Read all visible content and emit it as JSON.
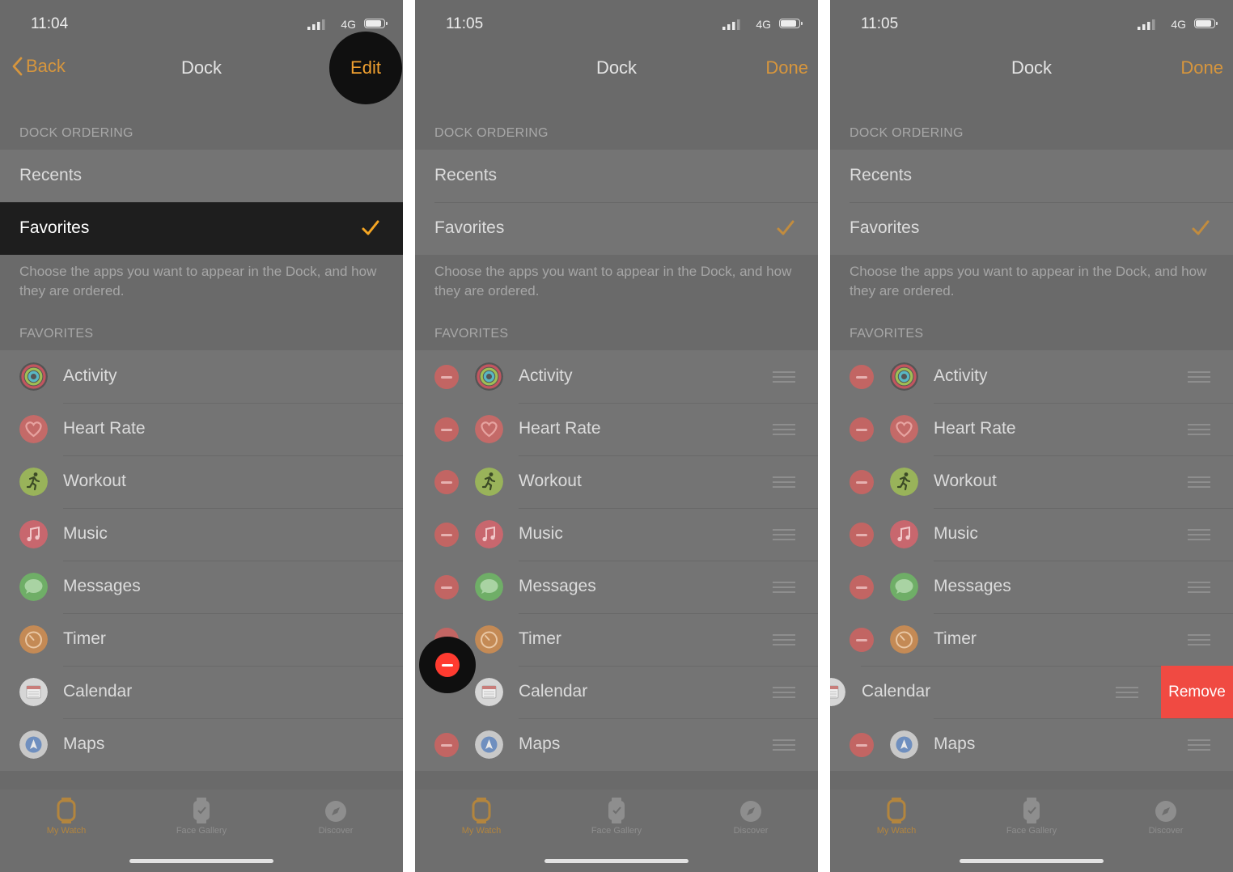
{
  "status": {
    "time_1": "11:04",
    "time_2": "11:05",
    "time_3": "11:05",
    "network": "4G"
  },
  "nav": {
    "back_label": "Back",
    "title": "Dock",
    "edit_label": "Edit",
    "done_label": "Done"
  },
  "dock_ordering": {
    "header": "DOCK ORDERING",
    "options": [
      "Recents",
      "Favorites"
    ],
    "selected": "Favorites",
    "description": "Choose the apps you want to appear in the Dock, and how they are ordered."
  },
  "favorites": {
    "header": "FAVORITES",
    "apps": [
      {
        "name": "Activity",
        "icon": "activity-rings-icon"
      },
      {
        "name": "Heart Rate",
        "icon": "heart-icon"
      },
      {
        "name": "Workout",
        "icon": "running-figure-icon"
      },
      {
        "name": "Music",
        "icon": "music-note-icon"
      },
      {
        "name": "Messages",
        "icon": "speech-bubble-icon"
      },
      {
        "name": "Timer",
        "icon": "timer-icon"
      },
      {
        "name": "Calendar",
        "icon": "calendar-icon"
      },
      {
        "name": "Maps",
        "icon": "map-arrow-icon"
      }
    ]
  },
  "remove_label": "Remove",
  "tabs": [
    {
      "label": "My Watch",
      "icon": "watch-icon",
      "active": true
    },
    {
      "label": "Face Gallery",
      "icon": "watch-face-icon",
      "active": false
    },
    {
      "label": "Discover",
      "icon": "compass-icon",
      "active": false
    }
  ],
  "colors": {
    "accent": "#d7963d",
    "delete": "#ff3b30",
    "remove": "#f04a42",
    "selected_row": "#1e1e1e"
  }
}
